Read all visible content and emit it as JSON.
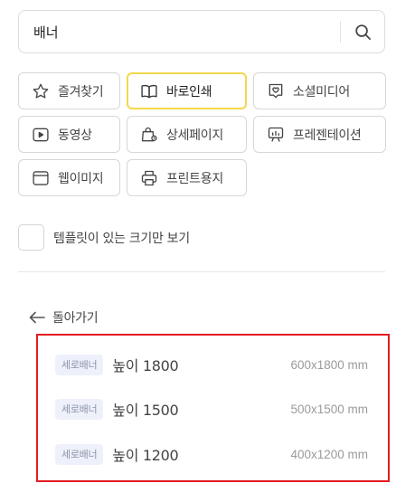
{
  "search": {
    "value": "배너",
    "placeholder": ""
  },
  "categories": [
    {
      "label": "즐겨찾기",
      "icon": "star-icon",
      "active": false
    },
    {
      "label": "바로인쇄",
      "icon": "book-open-icon",
      "active": true
    },
    {
      "label": "소셜미디어",
      "icon": "heart-pin-icon",
      "active": false
    },
    {
      "label": "동영상",
      "icon": "play-icon",
      "active": false
    },
    {
      "label": "상세페이지",
      "icon": "shopping-bag-icon",
      "active": false
    },
    {
      "label": "프레젠테이션",
      "icon": "presentation-icon",
      "active": false
    },
    {
      "label": "웹이미지",
      "icon": "browser-icon",
      "active": false
    },
    {
      "label": "프린트용지",
      "icon": "printer-icon",
      "active": false
    }
  ],
  "template_filter": {
    "label": "템플릿이 있는 크기만 보기",
    "checked": false
  },
  "back": {
    "label": "돌아가기"
  },
  "results": [
    {
      "badge": "세로배너",
      "title": "높이 1800",
      "size": "600x1800 mm"
    },
    {
      "badge": "세로배너",
      "title": "높이 1500",
      "size": "500x1500 mm"
    },
    {
      "badge": "세로배너",
      "title": "높이 1200",
      "size": "400x1200 mm"
    }
  ],
  "colors": {
    "active_border": "#f4d84a",
    "highlight_box": "#e31b23",
    "badge_bg": "#eef1fb"
  }
}
